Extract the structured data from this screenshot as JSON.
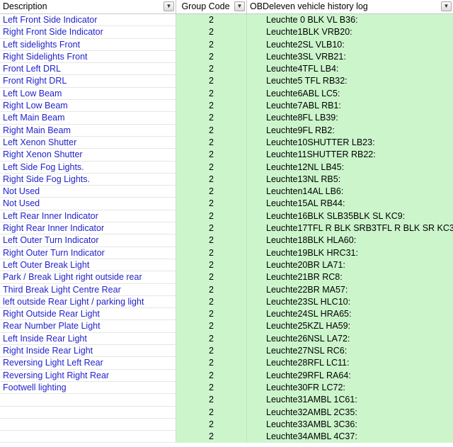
{
  "headers": {
    "description": "Description",
    "group_code": "Group Code",
    "log": "OBDeleven vehicle history log"
  },
  "rows": [
    {
      "desc": "Left Front Side Indicator",
      "code": "2",
      "log": "Leuchte 0 BLK VL B36:"
    },
    {
      "desc": "Right Front Side Indicator",
      "code": "2",
      "log": "Leuchte1BLK VRB20:"
    },
    {
      "desc": "Left sidelights Front",
      "code": "2",
      "log": "Leuchte2SL VLB10:"
    },
    {
      "desc": "Right Sidelights Front",
      "code": "2",
      "log": "Leuchte3SL VRB21:"
    },
    {
      "desc": "Front Left DRL",
      "code": "2",
      "log": "Leuchte4TFL LB4:"
    },
    {
      "desc": "Front Right DRL",
      "code": "2",
      "log": "Leuchte5 TFL RB32:"
    },
    {
      "desc": "Left Low Beam",
      "code": "2",
      "log": "Leuchte6ABL LC5:"
    },
    {
      "desc": "Right Low Beam",
      "code": "2",
      "log": "Leuchte7ABL RB1:"
    },
    {
      "desc": "Left Main Beam",
      "code": "2",
      "log": "Leuchte8FL LB39:"
    },
    {
      "desc": "Right Main Beam",
      "code": "2",
      "log": "Leuchte9FL RB2:"
    },
    {
      "desc": "Left Xenon Shutter",
      "code": "2",
      "log": "Leuchte10SHUTTER LB23:"
    },
    {
      "desc": "Right Xenon Shutter",
      "code": "2",
      "log": "Leuchte11SHUTTER RB22:"
    },
    {
      "desc": "Left Side Fog Lights.",
      "code": "2",
      "log": "Leuchte12NL LB45:"
    },
    {
      "desc": "Right Side Fog Lights.",
      "code": "2",
      "log": "Leuchte13NL RB5:"
    },
    {
      "desc": "Not Used",
      "code": "2",
      "log": "Leuchten14AL LB6:"
    },
    {
      "desc": "Not Used",
      "code": "2",
      "log": "Leuchte15AL RB44:"
    },
    {
      "desc": "Left Rear Inner Indicator",
      "code": "2",
      "log": "Leuchte16BLK SLB35BLK SL KC9:"
    },
    {
      "desc": "Right Rear Inner Indicator",
      "code": "2",
      "log": "Leuchte17TFL R BLK SRB3TFL R BLK SR KC3:"
    },
    {
      "desc": "Left Outer Turn Indicator",
      "code": "2",
      "log": "Leuchte18BLK HLA60:"
    },
    {
      "desc": "Right Outer Turn Indicator",
      "code": "2",
      "log": "Leuchte19BLK HRC31:"
    },
    {
      "desc": "Left Outer Break Light",
      "code": "2",
      "log": "Leuchte20BR LA71:"
    },
    {
      "desc": "Park / Break Light right outside rear",
      "code": "2",
      "log": "Leuchte21BR RC8:"
    },
    {
      "desc": "Third Break Light Centre Rear",
      "code": "2",
      "log": "Leuchte22BR MA57:"
    },
    {
      "desc": "left outside Rear Light / parking light",
      "code": "2",
      "log": "Leuchte23SL HLC10:"
    },
    {
      "desc": "Right Outside Rear Light",
      "code": "2",
      "log": "Leuchte24SL HRA65:"
    },
    {
      "desc": "Rear Number Plate Light",
      "code": "2",
      "log": "Leuchte25KZL HA59:"
    },
    {
      "desc": "Left Inside Rear Light",
      "code": "2",
      "log": "Leuchte26NSL LA72:"
    },
    {
      "desc": "Right Inside Rear Light",
      "code": "2",
      "log": "Leuchte27NSL RC6:"
    },
    {
      "desc": "Reversing Light Left Rear",
      "code": "2",
      "log": "Leuchte28RFL LC11:"
    },
    {
      "desc": "Reversing Light Right Rear",
      "code": "2",
      "log": "Leuchte29RFL RA64:"
    },
    {
      "desc": "Footwell lighting",
      "code": "2",
      "log": "Leuchte30FR LC72:"
    },
    {
      "desc": "",
      "code": "2",
      "log": "Leuchte31AMBL 1C61:"
    },
    {
      "desc": "",
      "code": "2",
      "log": "Leuchte32AMBL 2C35:"
    },
    {
      "desc": "",
      "code": "2",
      "log": "Leuchte33AMBL 3C36:"
    },
    {
      "desc": "",
      "code": "2",
      "log": "Leuchte34AMBL 4C37:"
    }
  ]
}
